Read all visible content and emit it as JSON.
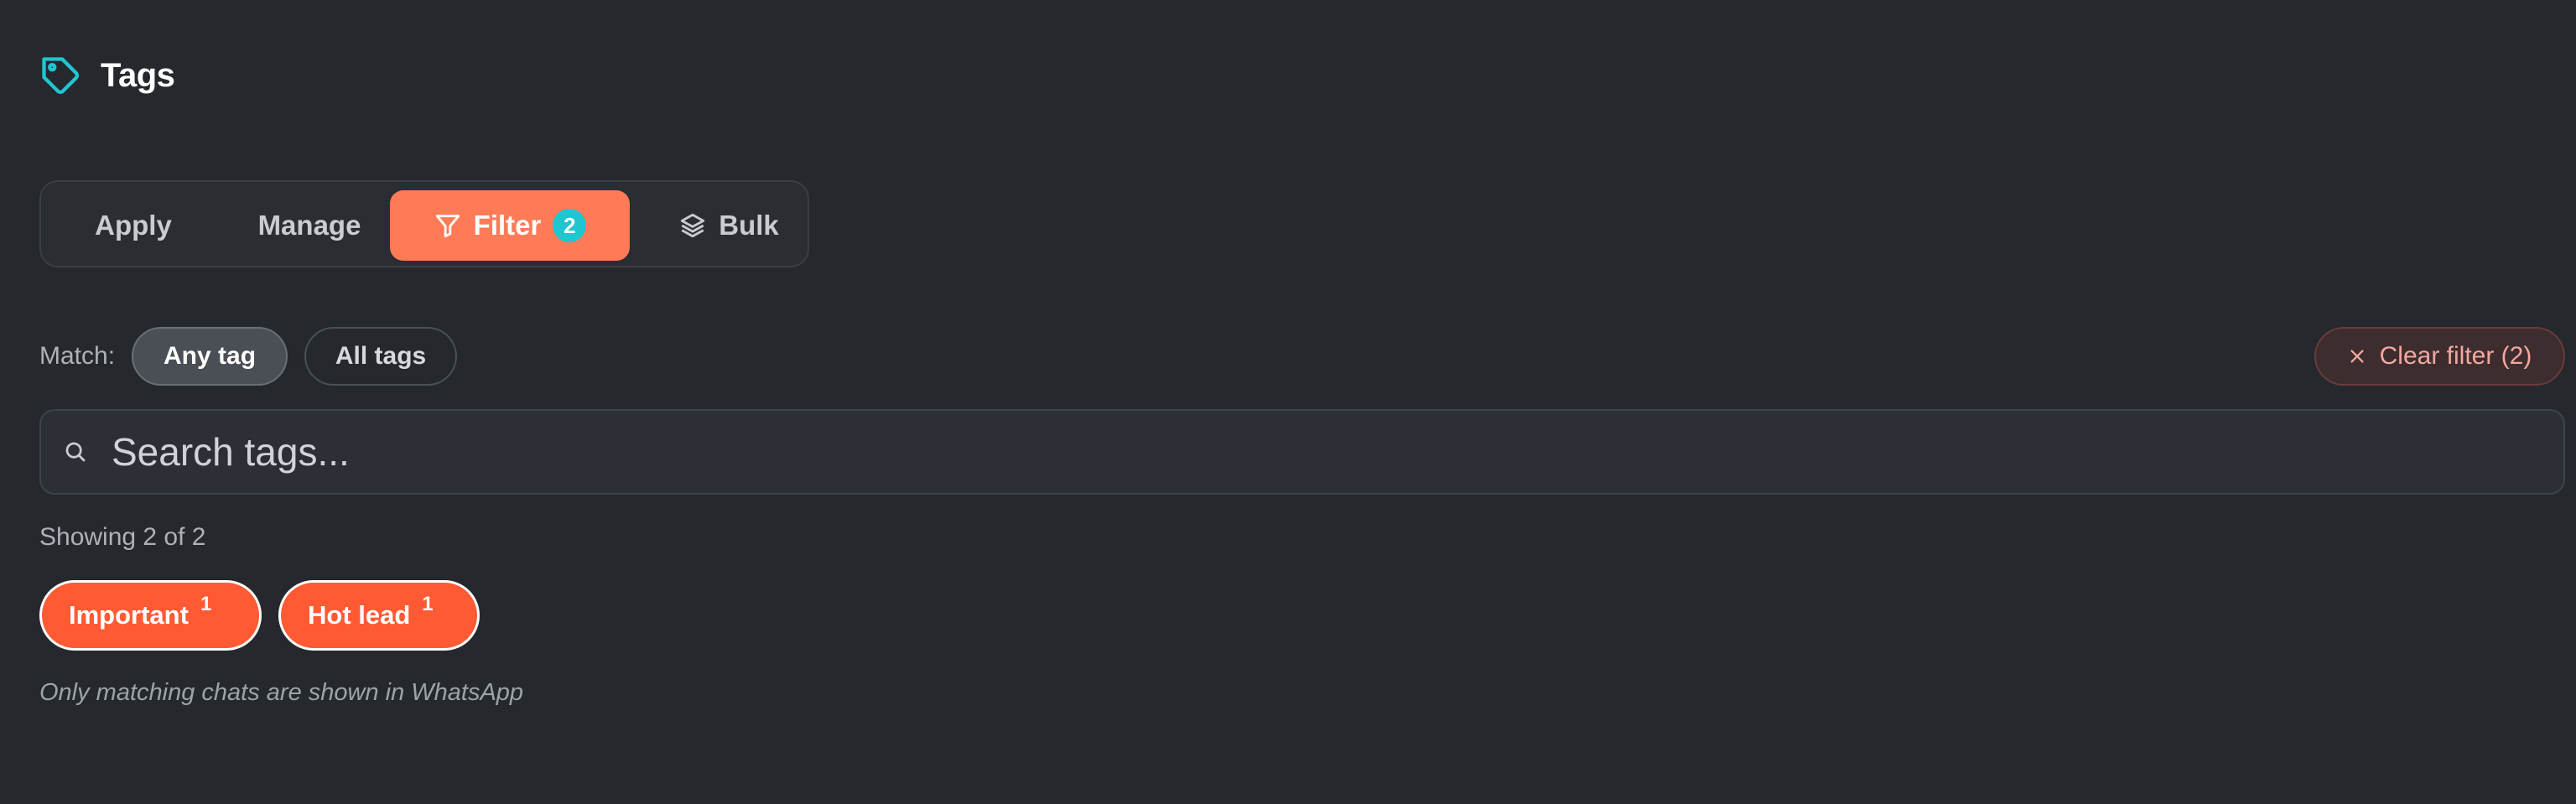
{
  "header": {
    "title": "Tags",
    "icon": "tag-icon",
    "accent": "#1fc6d0"
  },
  "tabs": [
    {
      "label": "Apply"
    },
    {
      "label": "Manage"
    },
    {
      "label": "Filter",
      "icon": "funnel-icon",
      "badge": "2",
      "active": true
    },
    {
      "label": "Bulk",
      "icon": "layers-icon"
    }
  ],
  "match": {
    "label": "Match:",
    "options": [
      {
        "label": "Any tag",
        "selected": true
      },
      {
        "label": "All tags",
        "selected": false
      }
    ]
  },
  "clear_filter": {
    "label": "Clear filter (2)",
    "icon": "close-icon"
  },
  "search": {
    "placeholder": "Search tags...",
    "value": ""
  },
  "showing": "Showing 2 of 2",
  "chips": [
    {
      "label": "Important",
      "count": "1"
    },
    {
      "label": "Hot lead",
      "count": "1"
    }
  ],
  "note": "Only matching chats are shown in WhatsApp",
  "colors": {
    "active_tab": "#ff7a57",
    "chip": "#ff5a34",
    "badge": "#1fc6d0",
    "background": "#25282d"
  }
}
